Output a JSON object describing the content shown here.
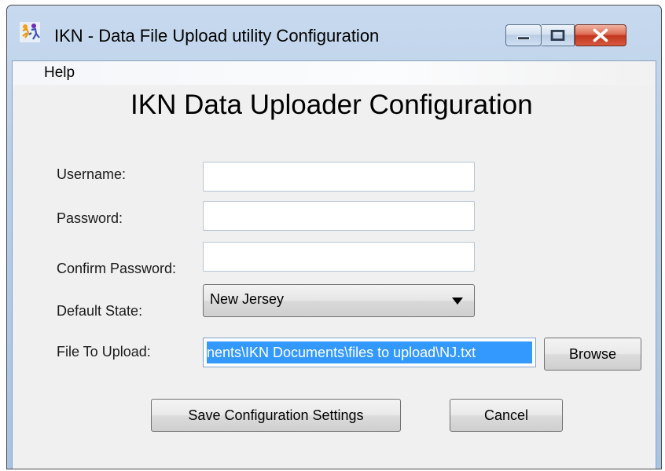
{
  "window": {
    "title": "IKN - Data File Upload utility Configuration",
    "app_icon": "runner-app-icon"
  },
  "menu": {
    "items": [
      {
        "label": "Help"
      }
    ]
  },
  "form": {
    "heading": "IKN Data Uploader Configuration",
    "username_label": "Username:",
    "username_value": "",
    "password_label": "Password:",
    "password_value": "",
    "confirm_label": "Confirm Password:",
    "confirm_value": "",
    "state_label": "Default State:",
    "state_value": "New Jersey",
    "file_label": "File To Upload:",
    "file_value": "nents\\IKN Documents\\files to upload\\NJ.txt"
  },
  "buttons": {
    "browse": "Browse",
    "save": "Save Configuration Settings",
    "cancel": "Cancel"
  },
  "colors": {
    "selection": "#3399ff",
    "dialog_bg": "#f0f0f0",
    "close_button": "#c2361f"
  }
}
